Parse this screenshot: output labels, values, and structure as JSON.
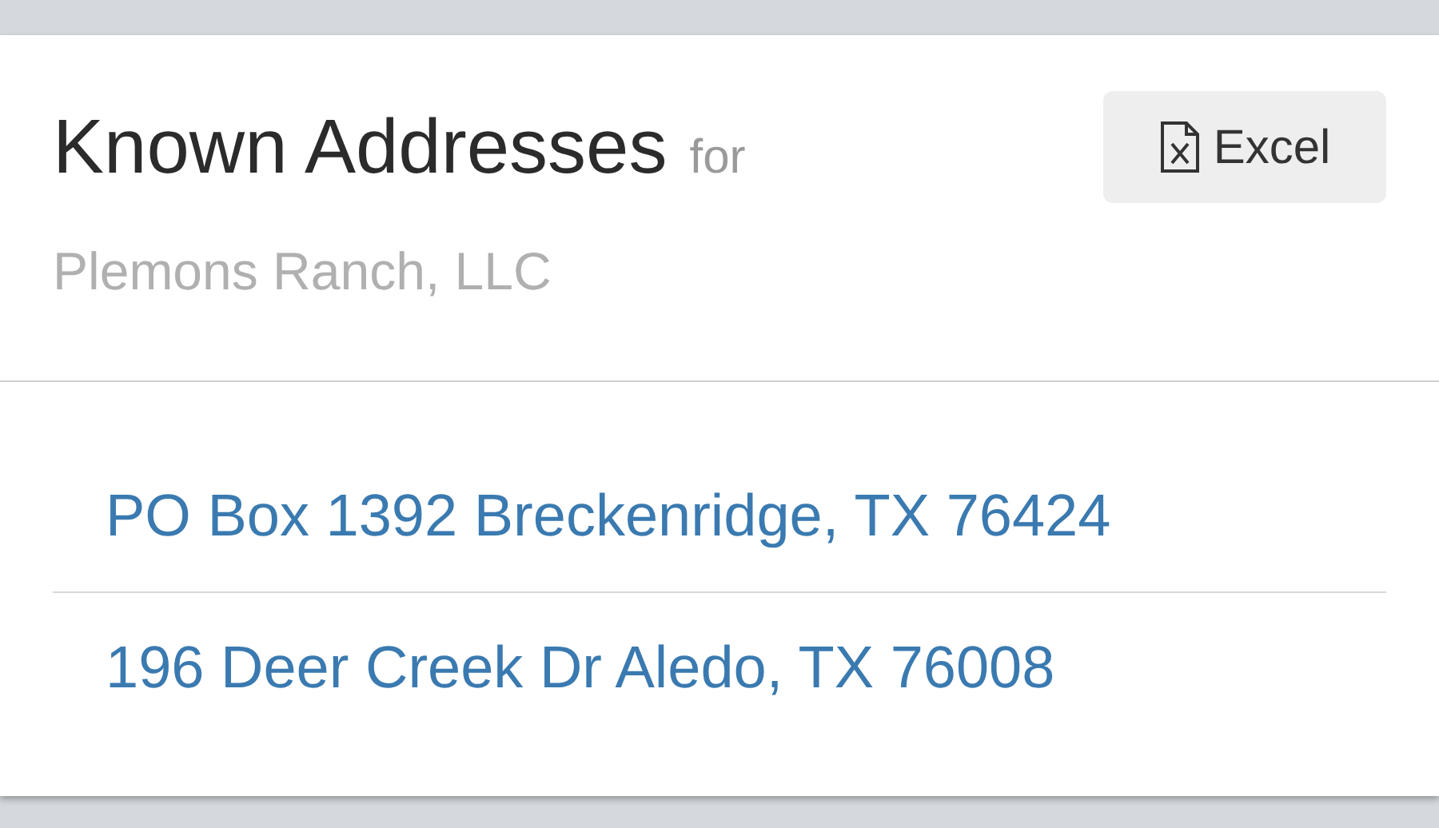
{
  "header": {
    "title": "Known Addresses",
    "title_suffix": "for",
    "subtitle": "Plemons Ranch, LLC",
    "export_button": "Excel"
  },
  "addresses": [
    "PO Box 1392 Breckenridge, TX 76424",
    "196 Deer Creek Dr Aledo, TX 76008"
  ]
}
